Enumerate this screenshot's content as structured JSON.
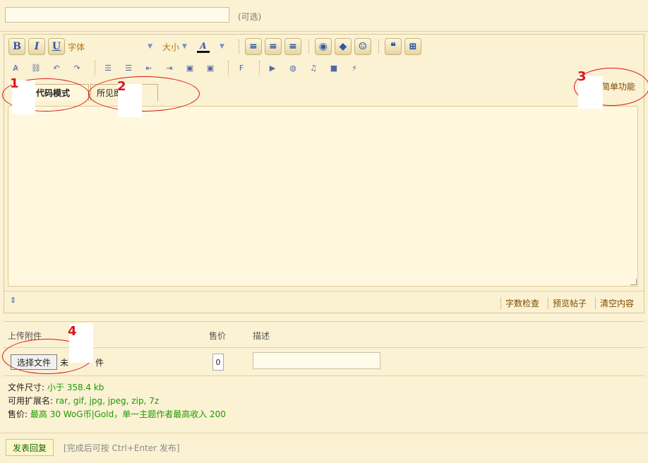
{
  "top": {
    "optional_label": "(可选)"
  },
  "toolbar": {
    "bold": "B",
    "italic": "I",
    "underline": "U",
    "font_label": "字体",
    "size_label": "大小",
    "color_label": "A"
  },
  "tabs": {
    "code_mode": "代码模式",
    "wysiwyg_mode": "所见即 式",
    "simple_mode": "简单功能"
  },
  "editor_footer": {
    "word_count": "字数检查",
    "preview": "预览帖子",
    "clear": "清空内容"
  },
  "attachments": {
    "header_upload": "上传附件",
    "header_price": "售价",
    "header_desc": "描述",
    "file_button": "选择文件",
    "file_status_prefix": "未",
    "file_status_suffix": "件",
    "price_value": "0",
    "info": [
      {
        "label": "文件尺寸:",
        "value": "小于 358.4 kb"
      },
      {
        "label": "可用扩展名:",
        "value": "rar, gif, jpg, jpeg, zip, 7z"
      },
      {
        "label": "售价:",
        "value": "最高 30 WoG币|Gold，单一主题作者最高收入 200"
      }
    ]
  },
  "submit": {
    "button": "发表回复",
    "hint": "[完成后可按 Ctrl+Enter 发布]"
  },
  "annotations": [
    "1",
    "2",
    "3",
    "4"
  ],
  "colors": {
    "background": "#fbf1d3",
    "accent_red": "#d81717",
    "green": "#1d9a00"
  }
}
